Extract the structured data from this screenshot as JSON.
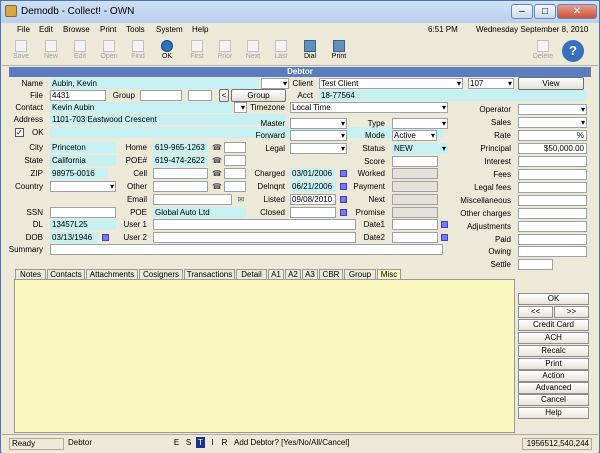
{
  "window": {
    "title": "Demodb - Collect! - OWN"
  },
  "menu": [
    "File",
    "Edit",
    "Browse",
    "Print",
    "Tools",
    "System",
    "Help"
  ],
  "menu_clock": {
    "time": "6:51 PM",
    "date": "Wednesday September 8, 2010"
  },
  "toolbar": {
    "save": "Save",
    "new": "New",
    "edit": "Edit",
    "open": "Open",
    "find": "Find",
    "ok": "OK",
    "first": "First",
    "prior": "Prior",
    "next": "Next",
    "last": "Last",
    "dial": "Dial",
    "print": "Print",
    "delete": "Delete"
  },
  "section_title": "Debtor",
  "labels": {
    "name": "Name",
    "file": "File",
    "group": "Group",
    "group_btn": "Group",
    "contact": "Contact",
    "address": "Address",
    "ok": "OK",
    "city": "City",
    "state": "State",
    "zip": "ZIP",
    "country": "Country",
    "ssn": "SSN",
    "dl": "DL",
    "dob": "DOB",
    "summary": "Summary",
    "home": "Home",
    "poe_num": "POE#",
    "cell": "Cell",
    "other": "Other",
    "email": "Email",
    "poe": "POE",
    "user1": "User 1",
    "user2": "User 2",
    "client": "Client",
    "acct": "Acct",
    "timezone": "Timezone",
    "view": "View",
    "master": "Master",
    "forward": "Forward",
    "legal": "Legal",
    "charged": "Charged",
    "delnqnt": "Delnqnt",
    "listed": "Listed",
    "closed": "Closed",
    "type": "Type",
    "mode": "Mode",
    "status": "Status",
    "score": "Score",
    "worked": "Worked",
    "payment": "Payment",
    "next": "Next",
    "promise": "Promise",
    "date1": "Date1",
    "date2": "Date2",
    "operator": "Operator",
    "sales": "Sales",
    "rate": "Rate",
    "principal": "Principal",
    "interest": "Interest",
    "fees": "Fees",
    "legal_fees": "Legal fees",
    "miscellaneous": "Miscellaneous",
    "other_charges": "Other charges",
    "adjustments": "Adjustments",
    "paid": "Paid",
    "owing": "Owing",
    "settle": "Settle"
  },
  "values": {
    "name": "Aubin, Kevin",
    "file": "4431",
    "client": "Test Client",
    "client_num": "107",
    "acct": "18-77564",
    "contact": "Kevin Aubin",
    "timezone": "Local Time",
    "address": "1101-703 Eastwood Crescent",
    "city": "Princeton",
    "state": "California",
    "zip": "98975-0016",
    "home": "619-965-1263",
    "poe_num": "619-474-2622",
    "poe": "Global Auto Ltd",
    "dl": "13457L25",
    "dob": "03/13/1946",
    "charged": "03/01/2006",
    "delnqnt": "06/21/2006",
    "listed": "09/08/2010",
    "mode": "Active",
    "status": "NEW",
    "rate": "%",
    "principal": "$50,000.00"
  },
  "tabs": [
    "Notes",
    "Contacts",
    "Attachments",
    "Cosigners",
    "Transactions",
    "Detail",
    "A1",
    "A2",
    "A3",
    "CBR",
    "Group",
    "Misc"
  ],
  "side_buttons": {
    "ok": "OK",
    "prev": "<<",
    "next": ">>",
    "credit_card": "Credit Card",
    "ach": "ACH",
    "recalc": "Recalc",
    "print": "Print",
    "action": "Action",
    "advanced": "Advanced",
    "cancel": "Cancel",
    "help": "Help"
  },
  "status": {
    "ready": "Ready",
    "form": "Debtor",
    "flags": [
      "E",
      "S",
      "T",
      "I",
      "R"
    ],
    "message": "Add Debtor? [Yes/No/All/Cancel]",
    "counter": "1956512,540,244"
  }
}
